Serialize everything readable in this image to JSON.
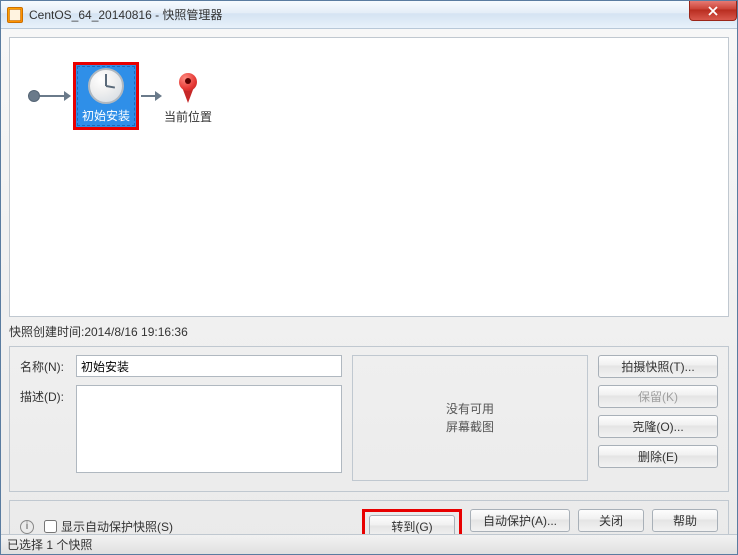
{
  "window": {
    "title": "CentOS_64_20140816 - 快照管理器"
  },
  "timeline": {
    "snapshot_label": "初始安装",
    "current_label": "当前位置"
  },
  "details": {
    "created_label": "快照创建时间:2014/8/16 19:16:36",
    "name_label": "名称(N):",
    "name_value": "初始安装",
    "desc_label": "描述(D):",
    "desc_value": "",
    "no_screenshot_line1": "没有可用",
    "no_screenshot_line2": "屏幕截图"
  },
  "side_buttons": {
    "take": "拍摄快照(T)...",
    "keep": "保留(K)",
    "clone": "克隆(O)...",
    "delete": "删除(E)"
  },
  "bottom": {
    "show_auto": "显示自动保护快照(S)",
    "goto": "转到(G)",
    "auto_protect": "自动保护(A)...",
    "close": "关闭",
    "help": "帮助"
  },
  "status": "已选择 1 个快照"
}
